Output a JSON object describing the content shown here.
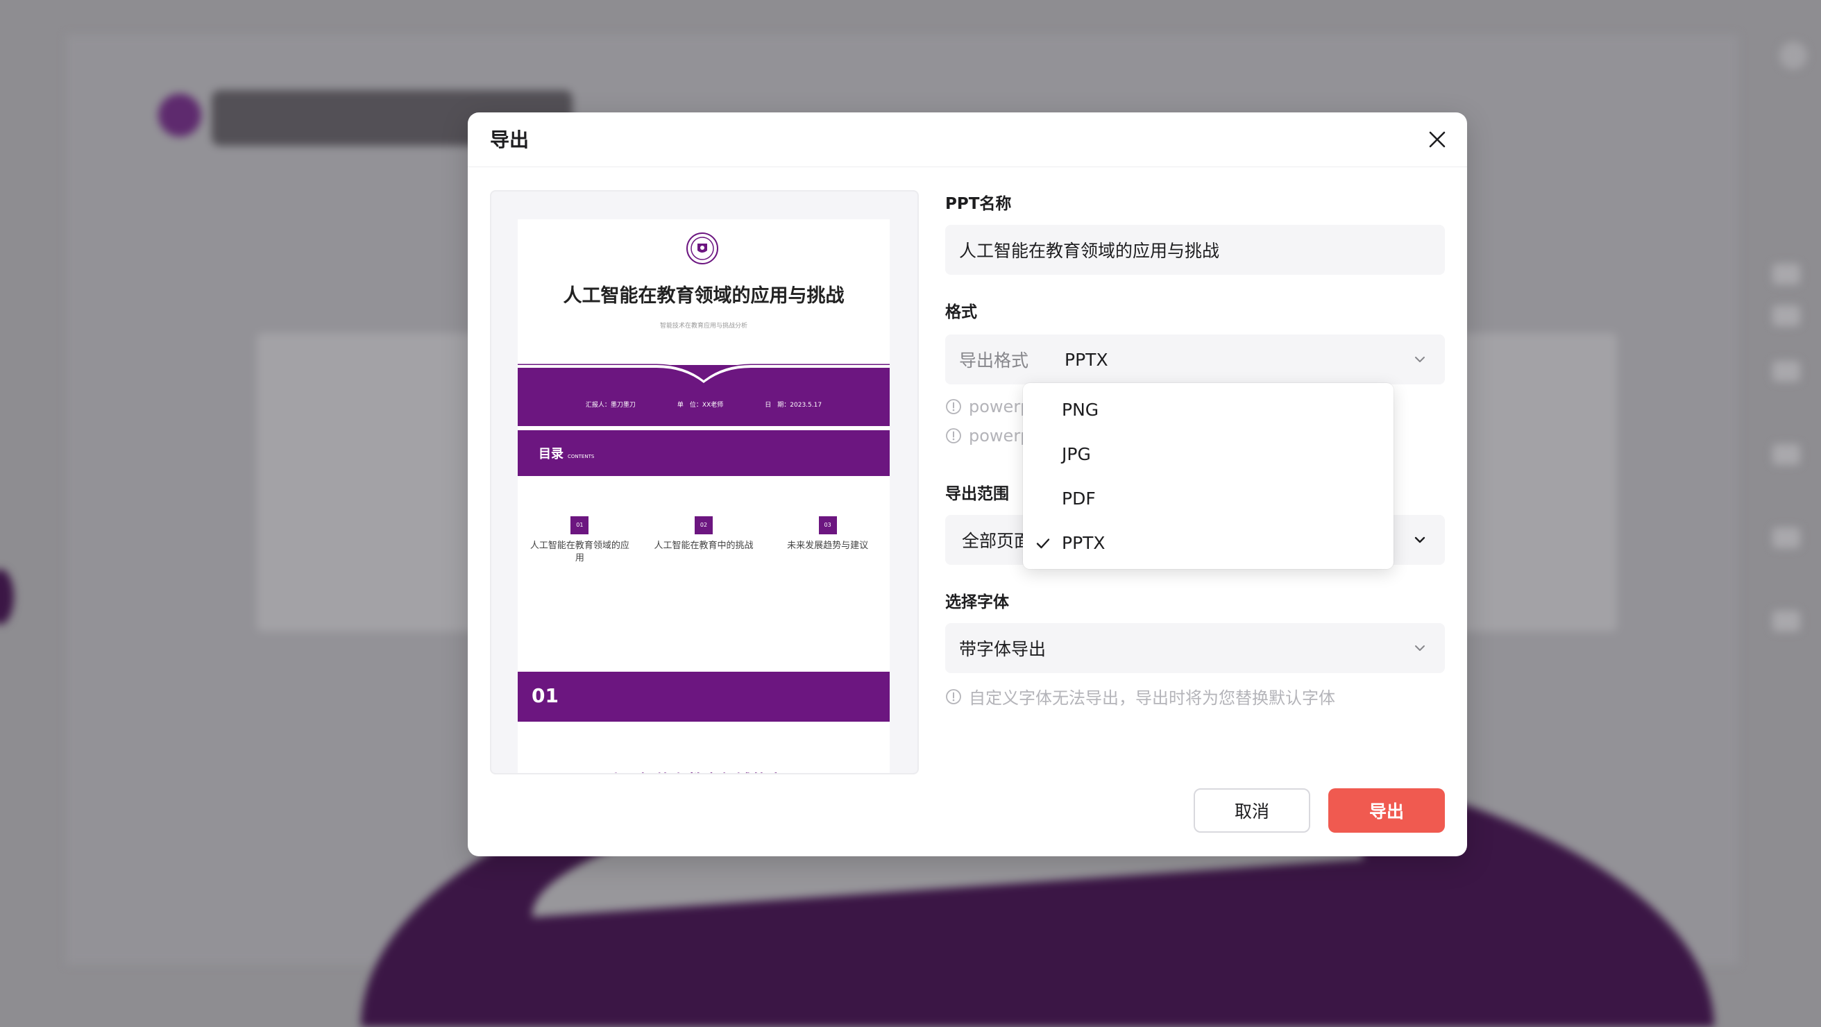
{
  "dialog": {
    "title": "导出"
  },
  "preview": {
    "slide_title": "人工智能在教育领域的应用与挑战",
    "slide_subtitle": "智能技术在教育应用与挑战分析",
    "meta": [
      "汇报人：墨刀墨刀",
      "单　位：XX老师",
      "日　期：2023.5.17"
    ],
    "toc_label": "目录",
    "toc_label_en": "CONTENTS",
    "toc_items": [
      {
        "num": "01",
        "text": "人工智能在教育领域的应用"
      },
      {
        "num": "02",
        "text": "人工智能在教育中的挑战"
      },
      {
        "num": "03",
        "text": "未来发展趋势与建议"
      }
    ],
    "section_num": "01",
    "section_title": "人工智能在教育领域的应用",
    "accent_color": "#6c1680"
  },
  "form": {
    "name_label": "PPT名称",
    "name_value": "人工智能在教育领域的应用与挑战",
    "format_label": "格式",
    "format_prefix": "导出格式",
    "format_value": "PPTX",
    "format_hints": [
      "powerpoint",
      "powerpoint"
    ],
    "range_label": "导出范围",
    "range_value": "全部页面",
    "font_label": "选择字体",
    "font_value": "带字体导出",
    "font_hint": "自定义字体无法导出，导出时将为您替换默认字体"
  },
  "dropdown": {
    "options": [
      "PNG",
      "JPG",
      "PDF",
      "PPTX"
    ],
    "selected": "PPTX"
  },
  "buttons": {
    "cancel": "取消",
    "export": "导出"
  },
  "colors": {
    "primary_button": "#f05a50",
    "field_bg": "#f5f5f7"
  }
}
